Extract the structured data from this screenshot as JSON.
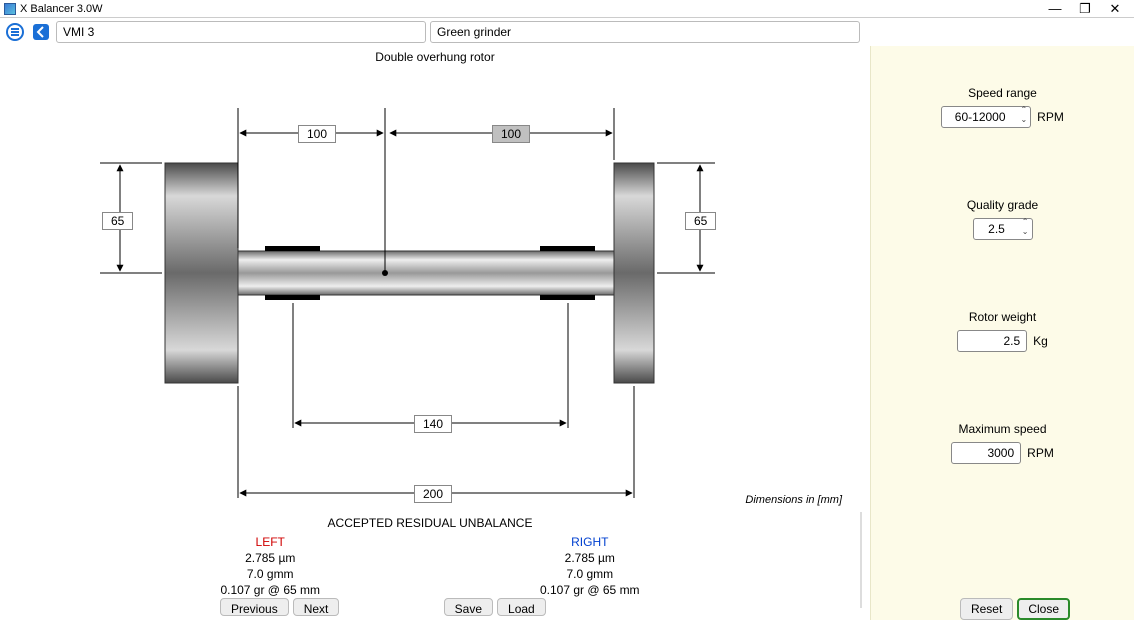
{
  "app": {
    "title": "X Balancer 3.0W"
  },
  "window_controls": {
    "min": "—",
    "max": "❐",
    "close": "✕"
  },
  "toolbar": {
    "field1": "VMI 3",
    "field2": "Green grinder"
  },
  "diagram": {
    "title": "Double overhung rotor",
    "dim_top_left": "100",
    "dim_top_right": "100",
    "dim_left_radius": "65",
    "dim_right_radius": "65",
    "dim_bearing_span": "140",
    "dim_total": "200",
    "note": "Dimensions in [mm]"
  },
  "side": {
    "speed_range": {
      "label": "Speed range",
      "value": "60-12000",
      "unit": "RPM"
    },
    "quality_grade": {
      "label": "Quality grade",
      "value": "2.5"
    },
    "rotor_weight": {
      "label": "Rotor weight",
      "value": "2.5",
      "unit": "Kg"
    },
    "max_speed": {
      "label": "Maximum speed",
      "value": "3000",
      "unit": "RPM"
    }
  },
  "aru": {
    "title": "ACCEPTED RESIDUAL UNBALANCE",
    "left": {
      "header": "LEFT",
      "line1": "2.785 µm",
      "line2": "7.0 gmm",
      "line3": "0.107 gr @ 65 mm"
    },
    "right": {
      "header": "RIGHT",
      "line1": "2.785 µm",
      "line2": "7.0 gmm",
      "line3": "0.107 gr @ 65 mm"
    }
  },
  "buttons": {
    "previous": "Previous",
    "next": "Next",
    "save": "Save",
    "load": "Load",
    "reset": "Reset",
    "close": "Close"
  }
}
